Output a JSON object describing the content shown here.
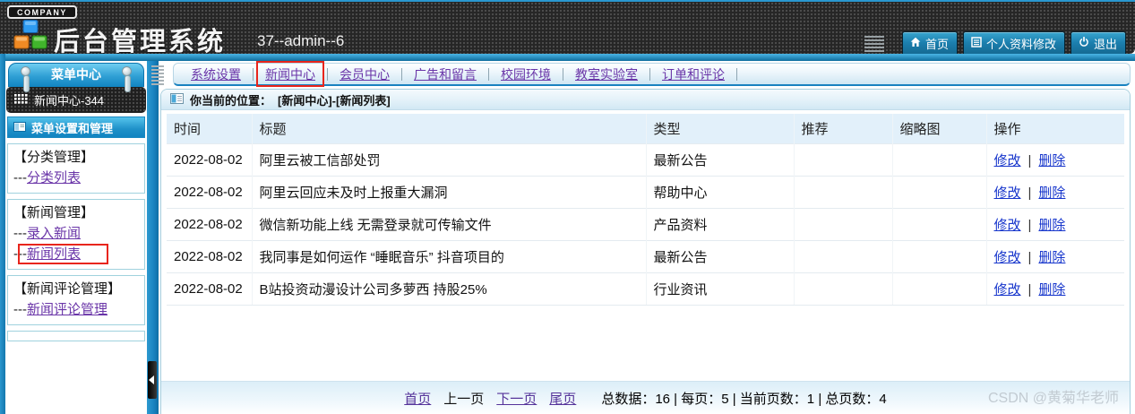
{
  "header": {
    "company_tab": "COMPANY",
    "app_title": "后台管理系统",
    "session_info": "37--admin--6",
    "actions": {
      "home": "首页",
      "profile": "个人资料修改",
      "logout": "退出"
    }
  },
  "sidebar": {
    "tab_title": "菜单中心",
    "module_label": "新闻中心-344",
    "section_title": "菜单设置和管理",
    "groups": [
      {
        "title": "【分类管理】",
        "links": [
          {
            "dash": "---",
            "label": "分类列表"
          }
        ]
      },
      {
        "title": "【新闻管理】",
        "links": [
          {
            "dash": "---",
            "label": "录入新闻"
          },
          {
            "dash": "---",
            "label": "新闻列表"
          }
        ]
      },
      {
        "title": "【新闻评论管理】",
        "links": [
          {
            "dash": "---",
            "label": "新闻评论管理"
          }
        ]
      }
    ]
  },
  "nav": {
    "items": [
      {
        "label": "系统设置"
      },
      {
        "label": "新闻中心"
      },
      {
        "label": "会员中心"
      },
      {
        "label": "广告和留言"
      },
      {
        "label": "校园环境"
      },
      {
        "label": "教室实验室"
      },
      {
        "label": "订单和评论"
      }
    ]
  },
  "breadcrumb": {
    "prefix": "你当前的位置：",
    "path": "[新闻中心]-[新闻列表]"
  },
  "table": {
    "columns": [
      "时间",
      "标题",
      "类型",
      "推荐",
      "缩略图",
      "操作"
    ],
    "action_labels": {
      "edit": "修改",
      "separator": "|",
      "delete": "删除"
    },
    "rows": [
      {
        "time": "2022-08-02",
        "title": "阿里云被工信部处罚",
        "type": "最新公告",
        "recommend": "",
        "thumbnail": ""
      },
      {
        "time": "2022-08-02",
        "title": "阿里云回应未及时上报重大漏洞",
        "type": "帮助中心",
        "recommend": "",
        "thumbnail": ""
      },
      {
        "time": "2022-08-02",
        "title": "微信新功能上线 无需登录就可传输文件",
        "type": "产品资料",
        "recommend": "",
        "thumbnail": ""
      },
      {
        "time": "2022-08-02",
        "title": "我同事是如何运作 “睡眠音乐” 抖音项目的",
        "type": "最新公告",
        "recommend": "",
        "thumbnail": ""
      },
      {
        "time": "2022-08-02",
        "title": "B站投资动漫设计公司多萝西 持股25%",
        "type": "行业资讯",
        "recommend": "",
        "thumbnail": ""
      }
    ]
  },
  "pagination": {
    "first": "首页",
    "prev": "上一页",
    "next": "下一页",
    "last": "尾页",
    "summary": "总数据：16 | 每页：5 | 当前页数：1 | 总页数：4"
  },
  "watermark": "CSDN @黄菊华老师",
  "colors": {
    "accent_blue": "#1982c0",
    "nav_link": "#6a35a8",
    "table_link": "#1736cc",
    "highlight_red": "#e8251c"
  }
}
